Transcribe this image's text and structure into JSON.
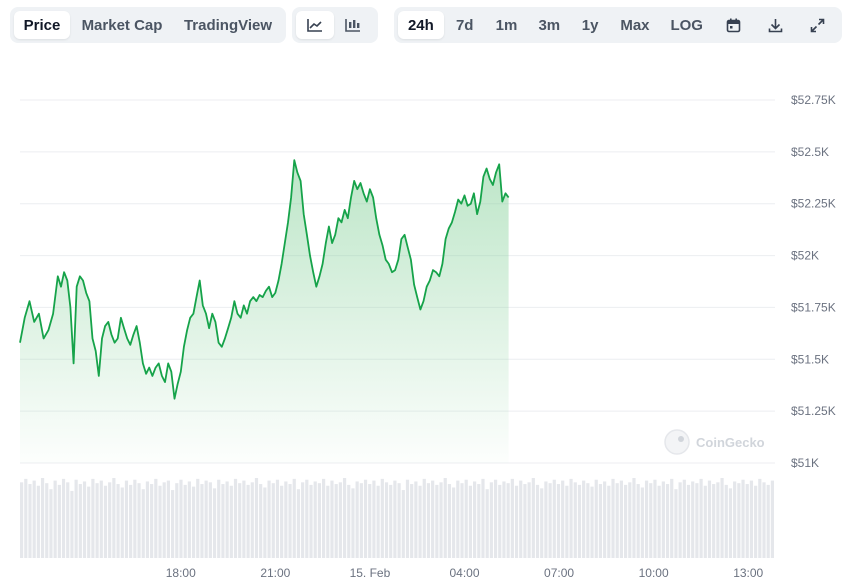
{
  "toolbar": {
    "view_tabs": [
      "Price",
      "Market Cap",
      "TradingView"
    ],
    "chart_type_icons": [
      "line-chart-icon",
      "candlestick-chart-icon"
    ],
    "ranges": [
      "24h",
      "7d",
      "1m",
      "3m",
      "1y",
      "Max",
      "LOG"
    ],
    "tool_icons": [
      "calendar-icon",
      "download-icon",
      "expand-icon"
    ],
    "active_view": "Price",
    "active_range": "24h"
  },
  "watermark": "CoinGecko",
  "colors": {
    "line": "#16a34a",
    "fill_top": "#86d19a",
    "volume": "#e5e7eb",
    "grid": "#eceef1",
    "axis_text": "#6b7280"
  },
  "chart_data": {
    "type": "area",
    "y_ticks": [
      "$52.75K",
      "$52.5K",
      "$52.25K",
      "$52K",
      "$51.75K",
      "$51.5K",
      "$51.25K",
      "$51K"
    ],
    "y_tick_values": [
      52750,
      52500,
      52250,
      52000,
      51750,
      51500,
      51250,
      51000
    ],
    "ylim": [
      51000,
      52750
    ],
    "x_ticks": [
      {
        "label": "18:00",
        "h": 3.35
      },
      {
        "label": "21:00",
        "h": 6.35
      },
      {
        "label": "15. Feb",
        "h": 9.35
      },
      {
        "label": "04:00",
        "h": 12.35
      },
      {
        "label": "07:00",
        "h": 15.35
      },
      {
        "label": "10:00",
        "h": 18.35
      },
      {
        "label": "13:00",
        "h": 21.35
      }
    ],
    "xlim": [
      -1.75,
      22.2
    ],
    "series": [
      {
        "points": [
          [
            -1.75,
            51580
          ],
          [
            -1.6,
            51700
          ],
          [
            -1.45,
            51780
          ],
          [
            -1.3,
            51680
          ],
          [
            -1.15,
            51720
          ],
          [
            -1.0,
            51600
          ],
          [
            -0.85,
            51640
          ],
          [
            -0.7,
            51720
          ],
          [
            -0.55,
            51900
          ],
          [
            -0.45,
            51850
          ],
          [
            -0.35,
            51920
          ],
          [
            -0.25,
            51880
          ],
          [
            -0.15,
            51750
          ],
          [
            -0.05,
            51480
          ],
          [
            0.05,
            51850
          ],
          [
            0.15,
            51900
          ],
          [
            0.25,
            51880
          ],
          [
            0.35,
            51820
          ],
          [
            0.45,
            51780
          ],
          [
            0.55,
            51600
          ],
          [
            0.65,
            51540
          ],
          [
            0.75,
            51420
          ],
          [
            0.85,
            51600
          ],
          [
            0.95,
            51660
          ],
          [
            1.05,
            51680
          ],
          [
            1.15,
            51620
          ],
          [
            1.25,
            51580
          ],
          [
            1.35,
            51600
          ],
          [
            1.45,
            51700
          ],
          [
            1.55,
            51650
          ],
          [
            1.65,
            51600
          ],
          [
            1.75,
            51570
          ],
          [
            1.85,
            51620
          ],
          [
            1.95,
            51660
          ],
          [
            2.05,
            51580
          ],
          [
            2.15,
            51480
          ],
          [
            2.25,
            51430
          ],
          [
            2.35,
            51460
          ],
          [
            2.45,
            51420
          ],
          [
            2.55,
            51460
          ],
          [
            2.65,
            51480
          ],
          [
            2.75,
            51420
          ],
          [
            2.85,
            51390
          ],
          [
            2.95,
            51480
          ],
          [
            3.05,
            51440
          ],
          [
            3.15,
            51310
          ],
          [
            3.25,
            51380
          ],
          [
            3.35,
            51440
          ],
          [
            3.45,
            51560
          ],
          [
            3.55,
            51640
          ],
          [
            3.65,
            51700
          ],
          [
            3.75,
            51720
          ],
          [
            3.85,
            51800
          ],
          [
            3.95,
            51880
          ],
          [
            4.05,
            51760
          ],
          [
            4.15,
            51720
          ],
          [
            4.25,
            51650
          ],
          [
            4.35,
            51720
          ],
          [
            4.45,
            51680
          ],
          [
            4.55,
            51580
          ],
          [
            4.65,
            51560
          ],
          [
            4.75,
            51600
          ],
          [
            4.85,
            51650
          ],
          [
            4.95,
            51700
          ],
          [
            5.05,
            51780
          ],
          [
            5.15,
            51720
          ],
          [
            5.25,
            51700
          ],
          [
            5.35,
            51760
          ],
          [
            5.45,
            51720
          ],
          [
            5.55,
            51780
          ],
          [
            5.65,
            51800
          ],
          [
            5.75,
            51780
          ],
          [
            5.85,
            51810
          ],
          [
            5.95,
            51800
          ],
          [
            6.05,
            51830
          ],
          [
            6.15,
            51850
          ],
          [
            6.25,
            51800
          ],
          [
            6.35,
            51820
          ],
          [
            6.45,
            51880
          ],
          [
            6.55,
            51960
          ],
          [
            6.65,
            52060
          ],
          [
            6.75,
            52160
          ],
          [
            6.85,
            52280
          ],
          [
            6.95,
            52460
          ],
          [
            7.05,
            52400
          ],
          [
            7.15,
            52360
          ],
          [
            7.25,
            52200
          ],
          [
            7.35,
            52100
          ],
          [
            7.45,
            52000
          ],
          [
            7.55,
            51920
          ],
          [
            7.65,
            51850
          ],
          [
            7.75,
            51900
          ],
          [
            7.85,
            51960
          ],
          [
            7.95,
            52060
          ],
          [
            8.05,
            52140
          ],
          [
            8.15,
            52060
          ],
          [
            8.25,
            52100
          ],
          [
            8.35,
            52180
          ],
          [
            8.45,
            52160
          ],
          [
            8.55,
            52220
          ],
          [
            8.65,
            52180
          ],
          [
            8.75,
            52280
          ],
          [
            8.85,
            52360
          ],
          [
            8.95,
            52320
          ],
          [
            9.05,
            52350
          ],
          [
            9.15,
            52300
          ],
          [
            9.25,
            52260
          ],
          [
            9.35,
            52320
          ],
          [
            9.45,
            52280
          ],
          [
            9.55,
            52180
          ],
          [
            9.65,
            52100
          ],
          [
            9.75,
            52050
          ],
          [
            9.85,
            51980
          ],
          [
            9.95,
            51960
          ],
          [
            10.05,
            51920
          ],
          [
            10.15,
            51930
          ],
          [
            10.25,
            51980
          ],
          [
            10.35,
            52080
          ],
          [
            10.45,
            52100
          ],
          [
            10.55,
            52040
          ],
          [
            10.65,
            51980
          ],
          [
            10.75,
            51860
          ],
          [
            10.85,
            51800
          ],
          [
            10.95,
            51740
          ],
          [
            11.05,
            51780
          ],
          [
            11.15,
            51850
          ],
          [
            11.25,
            51880
          ],
          [
            11.35,
            51930
          ],
          [
            11.45,
            51920
          ],
          [
            11.55,
            51900
          ],
          [
            11.65,
            51960
          ],
          [
            11.75,
            52080
          ],
          [
            11.85,
            52130
          ],
          [
            11.95,
            52160
          ],
          [
            12.05,
            52210
          ],
          [
            12.15,
            52270
          ],
          [
            12.25,
            52250
          ],
          [
            12.35,
            52290
          ],
          [
            12.45,
            52240
          ],
          [
            12.55,
            52250
          ],
          [
            12.65,
            52300
          ],
          [
            12.75,
            52200
          ],
          [
            12.85,
            52260
          ],
          [
            12.95,
            52380
          ],
          [
            13.05,
            52420
          ],
          [
            13.15,
            52370
          ],
          [
            13.25,
            52340
          ],
          [
            13.35,
            52400
          ],
          [
            13.45,
            52440
          ],
          [
            13.55,
            52260
          ],
          [
            13.65,
            52300
          ],
          [
            13.75,
            52280
          ]
        ]
      }
    ],
    "volume": [
      0.88,
      0.92,
      0.86,
      0.9,
      0.84,
      0.93,
      0.87,
      0.8,
      0.9,
      0.85,
      0.92,
      0.88,
      0.78,
      0.91,
      0.86,
      0.89,
      0.83,
      0.92,
      0.87,
      0.9,
      0.84,
      0.88,
      0.93,
      0.86,
      0.82,
      0.9,
      0.85,
      0.91,
      0.87,
      0.8,
      0.89,
      0.86,
      0.92,
      0.84,
      0.88,
      0.9,
      0.79,
      0.87,
      0.91,
      0.85,
      0.89,
      0.83,
      0.92,
      0.86,
      0.9,
      0.88,
      0.81,
      0.91,
      0.86,
      0.89,
      0.84,
      0.92,
      0.87,
      0.9,
      0.85,
      0.88,
      0.93,
      0.86,
      0.82,
      0.9,
      0.87,
      0.91,
      0.84,
      0.89,
      0.86,
      0.92,
      0.8,
      0.88,
      0.91,
      0.85,
      0.89,
      0.87,
      0.92,
      0.84,
      0.9,
      0.86,
      0.88,
      0.93,
      0.85,
      0.81,
      0.89,
      0.87,
      0.91,
      0.86,
      0.9,
      0.84,
      0.92,
      0.88,
      0.85,
      0.9,
      0.87,
      0.79,
      0.91,
      0.86,
      0.89,
      0.84,
      0.92,
      0.87,
      0.9,
      0.85,
      0.88,
      0.93,
      0.86,
      0.82,
      0.9,
      0.87,
      0.91,
      0.84,
      0.89,
      0.86,
      0.92,
      0.8,
      0.88,
      0.91,
      0.85,
      0.89,
      0.87,
      0.92,
      0.84,
      0.9,
      0.86,
      0.88,
      0.93,
      0.85,
      0.81,
      0.89,
      0.87,
      0.91,
      0.86,
      0.9,
      0.84,
      0.92,
      0.88,
      0.85,
      0.9,
      0.87,
      0.83,
      0.91,
      0.86,
      0.89,
      0.84,
      0.92,
      0.87,
      0.9,
      0.85,
      0.88,
      0.93,
      0.86,
      0.82,
      0.9,
      0.87,
      0.91,
      0.84,
      0.89,
      0.86,
      0.92,
      0.8,
      0.88,
      0.91,
      0.85,
      0.89,
      0.87,
      0.92,
      0.84,
      0.9,
      0.86,
      0.88,
      0.93,
      0.85,
      0.81,
      0.89,
      0.87,
      0.91,
      0.86,
      0.9,
      0.84,
      0.92,
      0.88,
      0.85,
      0.9
    ],
    "grid": true,
    "legend": "none"
  }
}
